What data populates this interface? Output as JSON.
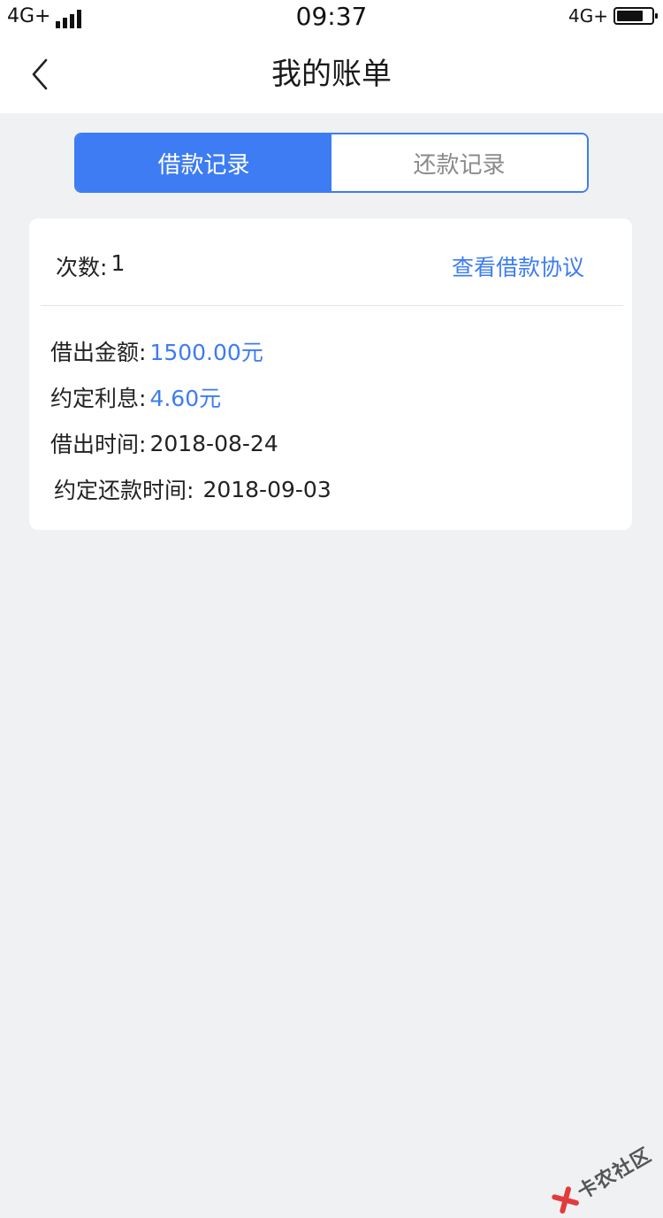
{
  "status_bar": {
    "network_left": "4G+",
    "time": "09:37",
    "network_right": "4G+",
    "battery_level": 0.75
  },
  "nav": {
    "title": "我的账单",
    "back_icon": "chevron-left-icon"
  },
  "tabs": [
    {
      "label": "借款记录",
      "active": true
    },
    {
      "label": "还款记录",
      "active": false
    }
  ],
  "card": {
    "count_label": "次数:",
    "count_value": "1",
    "agreement_link": "查看借款协议",
    "rows": [
      {
        "label": "借出金额:",
        "value": "1500.00元",
        "highlight": true
      },
      {
        "label": "约定利息:",
        "value": "4.60元",
        "highlight": true
      },
      {
        "label": "借出时间:",
        "value": "2018-08-24",
        "highlight": false
      },
      {
        "label": "约定还款时间:",
        "value": "2018-09-03",
        "highlight": false
      }
    ]
  },
  "watermark": {
    "text": "卡农社区"
  },
  "colors": {
    "accent": "#3d7cf2",
    "background": "#f0f1f2",
    "card": "#ffffff"
  }
}
